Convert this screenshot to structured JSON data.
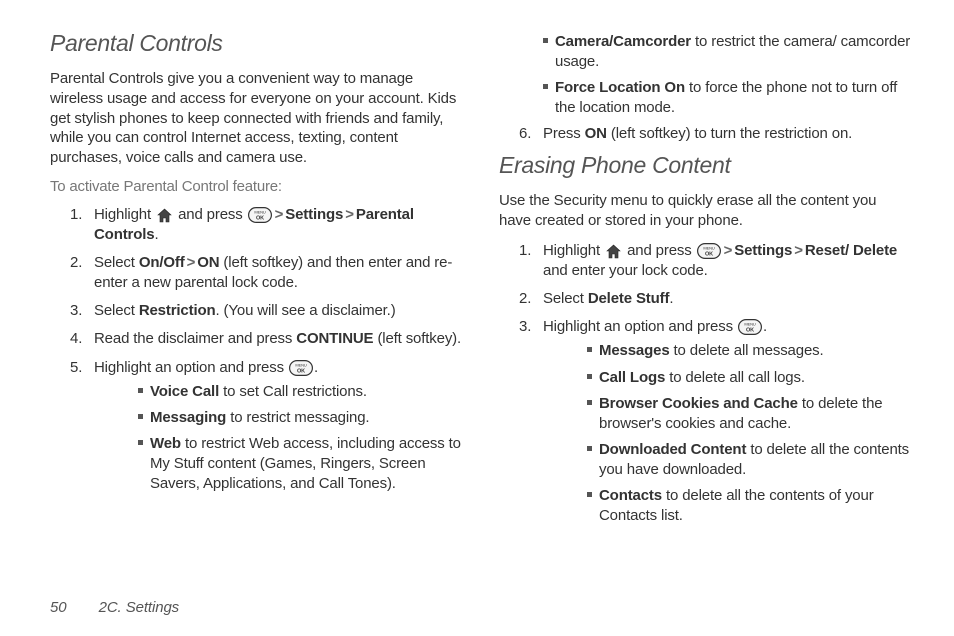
{
  "footer": {
    "page_number": "50",
    "section": "2C. Settings"
  },
  "left": {
    "heading": "Parental Controls",
    "intro": "Parental Controls give you a convenient way to manage wireless usage and access for everyone on your account. Kids get stylish phones to keep connected with friends and family, while you can control Internet access, texting, content purchases, voice calls and camera use.",
    "subhead": "To activate Parental Control feature:",
    "steps": {
      "s1": {
        "num": "1.",
        "a": "Highlight ",
        "b": " and press ",
        "c": "Settings",
        "d": "Parental Controls",
        "e": "."
      },
      "s2": {
        "num": "2.",
        "a": "Select ",
        "b": "On/Off",
        "c": "ON",
        "d": " (left softkey) and then enter and re-enter a new parental lock code."
      },
      "s3": {
        "num": "3.",
        "a": "Select ",
        "b": "Restriction",
        "c": ". (You will see a disclaimer.)"
      },
      "s4": {
        "num": "4.",
        "a": "Read the disclaimer and press ",
        "b": "CONTINUE",
        "c": " (left softkey)."
      },
      "s5": {
        "num": "5.",
        "a": "Highlight an option and press ",
        "b": "."
      }
    },
    "options": {
      "o1": {
        "b": "Voice Call",
        "t": " to set Call restrictions."
      },
      "o2": {
        "b": "Messaging",
        "t": " to restrict messaging."
      },
      "o3": {
        "b": "Web",
        "t": " to restrict Web access, including access to My Stuff content (Games, Ringers, Screen Savers, Applications, and Call Tones)."
      }
    }
  },
  "right": {
    "options_cont": {
      "o4": {
        "b": "Camera/Camcorder",
        "t": " to restrict the camera/ camcorder usage."
      },
      "o5": {
        "b": "Force Location On",
        "t": " to force the phone not to turn off the location mode."
      }
    },
    "step6": {
      "num": "6.",
      "a": "Press ",
      "b": "ON",
      "c": " (left softkey) to turn the restriction on."
    },
    "heading2": "Erasing Phone Content",
    "intro2": "Use the Security menu to quickly erase all the content you have created or stored in your phone.",
    "steps2": {
      "s1": {
        "num": "1.",
        "a": "Highlight ",
        "b": " and press ",
        "c": "Settings",
        "d": "Reset/ Delete",
        "e": " and enter your lock code."
      },
      "s2": {
        "num": "2.",
        "a": "Select ",
        "b": "Delete Stuff",
        "c": "."
      },
      "s3": {
        "num": "3.",
        "a": "Highlight an option and press ",
        "b": "."
      }
    },
    "options2": {
      "o1": {
        "b": "Messages",
        "t": " to delete all messages."
      },
      "o2": {
        "b": "Call Logs",
        "t": " to delete all call logs."
      },
      "o3": {
        "b": "Browser Cookies and Cache",
        "t": " to delete the browser's cookies and cache."
      },
      "o4": {
        "b": "Downloaded Content",
        "t": " to delete all the contents you have downloaded."
      },
      "o5": {
        "b": "Contacts",
        "t": " to delete all the contents of your Contacts list."
      }
    }
  },
  "glyphs": {
    "gt": ">"
  }
}
